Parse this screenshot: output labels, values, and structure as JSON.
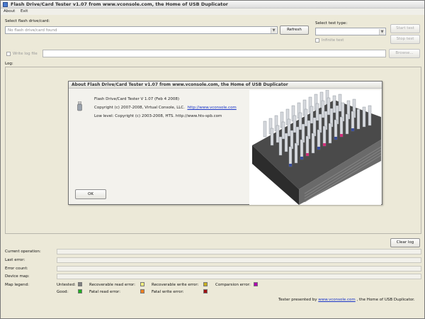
{
  "window": {
    "title": "Flash Drive/Card Tester v1.07 from www.vconsole.com, the Home of USB Duplicator"
  },
  "menu": [
    "About",
    "Exit"
  ],
  "drive": {
    "label": "Select flash drive/card:",
    "value": "No flash drive/card found",
    "refresh_label": "Refresh"
  },
  "test": {
    "label": "Select test type:",
    "value": "",
    "start_label": "Start test",
    "stop_label": "Stop test",
    "infinite_label": "Infinite test"
  },
  "logfile": {
    "label": "Write log file",
    "value": "",
    "browse_label": "Browse..."
  },
  "log": {
    "label": "Log:",
    "clear_label": "Clear log"
  },
  "about": {
    "title": "About Flash Drive/Card Tester v1.07 from www.vconsole.com, the Home of USB Duplicator",
    "version": "Flash Drive/Card Tester V  1.07  (Feb  4 2008)",
    "copyright_prefix": "Copyright (c) 2007-2008, Virtual Console, LLC.",
    "copyright_link": "http://www.vconsole.com",
    "lowlevel": "Low level: Copyright (c) 2003-2008, HTS. http://www.hts-spb.com",
    "ok_label": "OK"
  },
  "status": {
    "current_operation": "Current operation:",
    "last_error": "Last error:",
    "error_count": "Error count:",
    "device_map": "Device map:",
    "map_legend": "Map legend:"
  },
  "legend": [
    {
      "label": "Untested:",
      "color": "#808080"
    },
    {
      "label": "Recoverable read error:",
      "color": "#f4f080"
    },
    {
      "label": "Recoverable write error:",
      "color": "#c8b020"
    },
    {
      "label": "Comparsion error:",
      "color": "#b000b0"
    },
    {
      "label": "Good:",
      "color": "#20b020"
    },
    {
      "label": "Fatal read error:",
      "color": "#f08020"
    },
    {
      "label": "Fatal write error:",
      "color": "#a01010"
    }
  ],
  "footer": {
    "prefix": "Tester presented by",
    "link": "www.vconsole.com",
    "suffix": ", the Home of USB Duplicator."
  }
}
